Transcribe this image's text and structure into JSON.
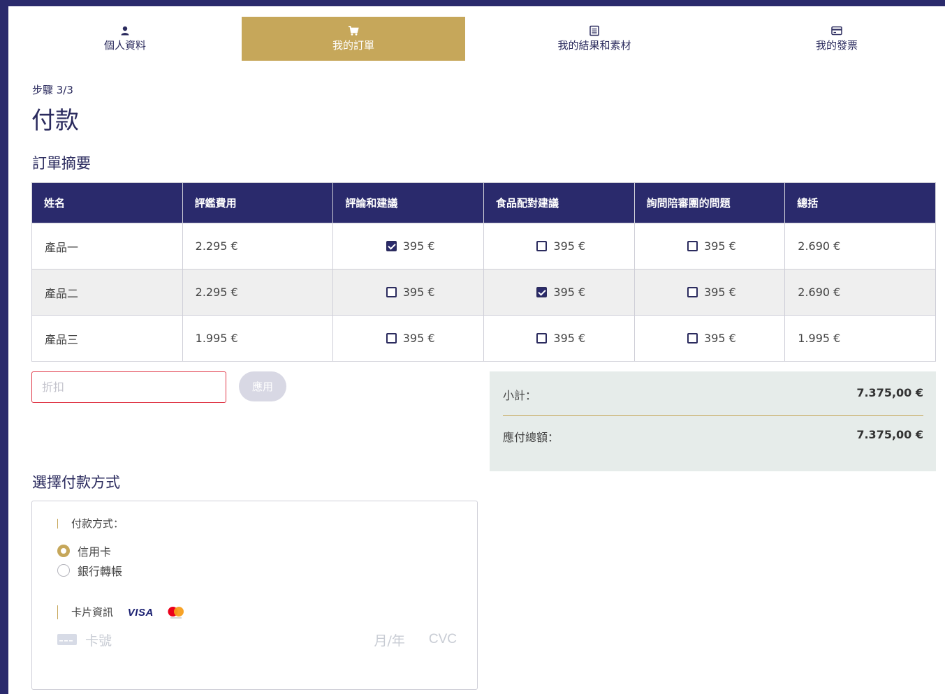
{
  "tabs": [
    {
      "label": "個人資料",
      "icon": "user-icon",
      "active": false
    },
    {
      "label": "我的訂單",
      "icon": "cart-icon",
      "active": true
    },
    {
      "label": "我的結果和素材",
      "icon": "document-icon",
      "active": false
    },
    {
      "label": "我的發票",
      "icon": "card-icon",
      "active": false
    }
  ],
  "step": "步驟 3/3",
  "title": "付款",
  "order_summary": {
    "heading": "訂單摘要",
    "columns": [
      "姓名",
      "評鑑費用",
      "評論和建議",
      "食品配對建議",
      "詢問陪審團的問題",
      "總括"
    ],
    "rows": [
      {
        "name": "產品一",
        "fee": "2.295 €",
        "opt1": {
          "checked": true,
          "price": "395 €"
        },
        "opt2": {
          "checked": false,
          "price": "395 €"
        },
        "opt3": {
          "checked": false,
          "price": "395 €"
        },
        "total": "2.690 €"
      },
      {
        "name": "產品二",
        "fee": "2.295 €",
        "opt1": {
          "checked": false,
          "price": "395 €"
        },
        "opt2": {
          "checked": true,
          "price": "395 €"
        },
        "opt3": {
          "checked": false,
          "price": "395 €"
        },
        "total": "2.690 €"
      },
      {
        "name": "產品三",
        "fee": "1.995 €",
        "opt1": {
          "checked": false,
          "price": "395 €"
        },
        "opt2": {
          "checked": false,
          "price": "395 €"
        },
        "opt3": {
          "checked": false,
          "price": "395 €"
        },
        "total": "1.995 €"
      }
    ]
  },
  "discount": {
    "placeholder": "折扣",
    "value": "",
    "apply_label": "應用"
  },
  "summary": {
    "subtotal_label": "小計：",
    "subtotal_value": "7.375,00 €",
    "total_label": "應付總額：",
    "total_value": "7.375,00 €"
  },
  "payment": {
    "heading": "選擇付款方式",
    "method_label": "付款方式：",
    "methods": [
      {
        "label": "信用卡",
        "selected": true
      },
      {
        "label": "銀行轉帳",
        "selected": false
      }
    ],
    "card_info_label": "卡片資訊",
    "visa_text": "VISA",
    "card_number_placeholder": "卡號",
    "expiry_placeholder": "月/年",
    "cvc_placeholder": "CVC"
  },
  "colors": {
    "navy": "#2a2a6c",
    "gold": "#c6a75a",
    "summary_bg": "#e6ecea",
    "error_red": "#e03a4a"
  }
}
